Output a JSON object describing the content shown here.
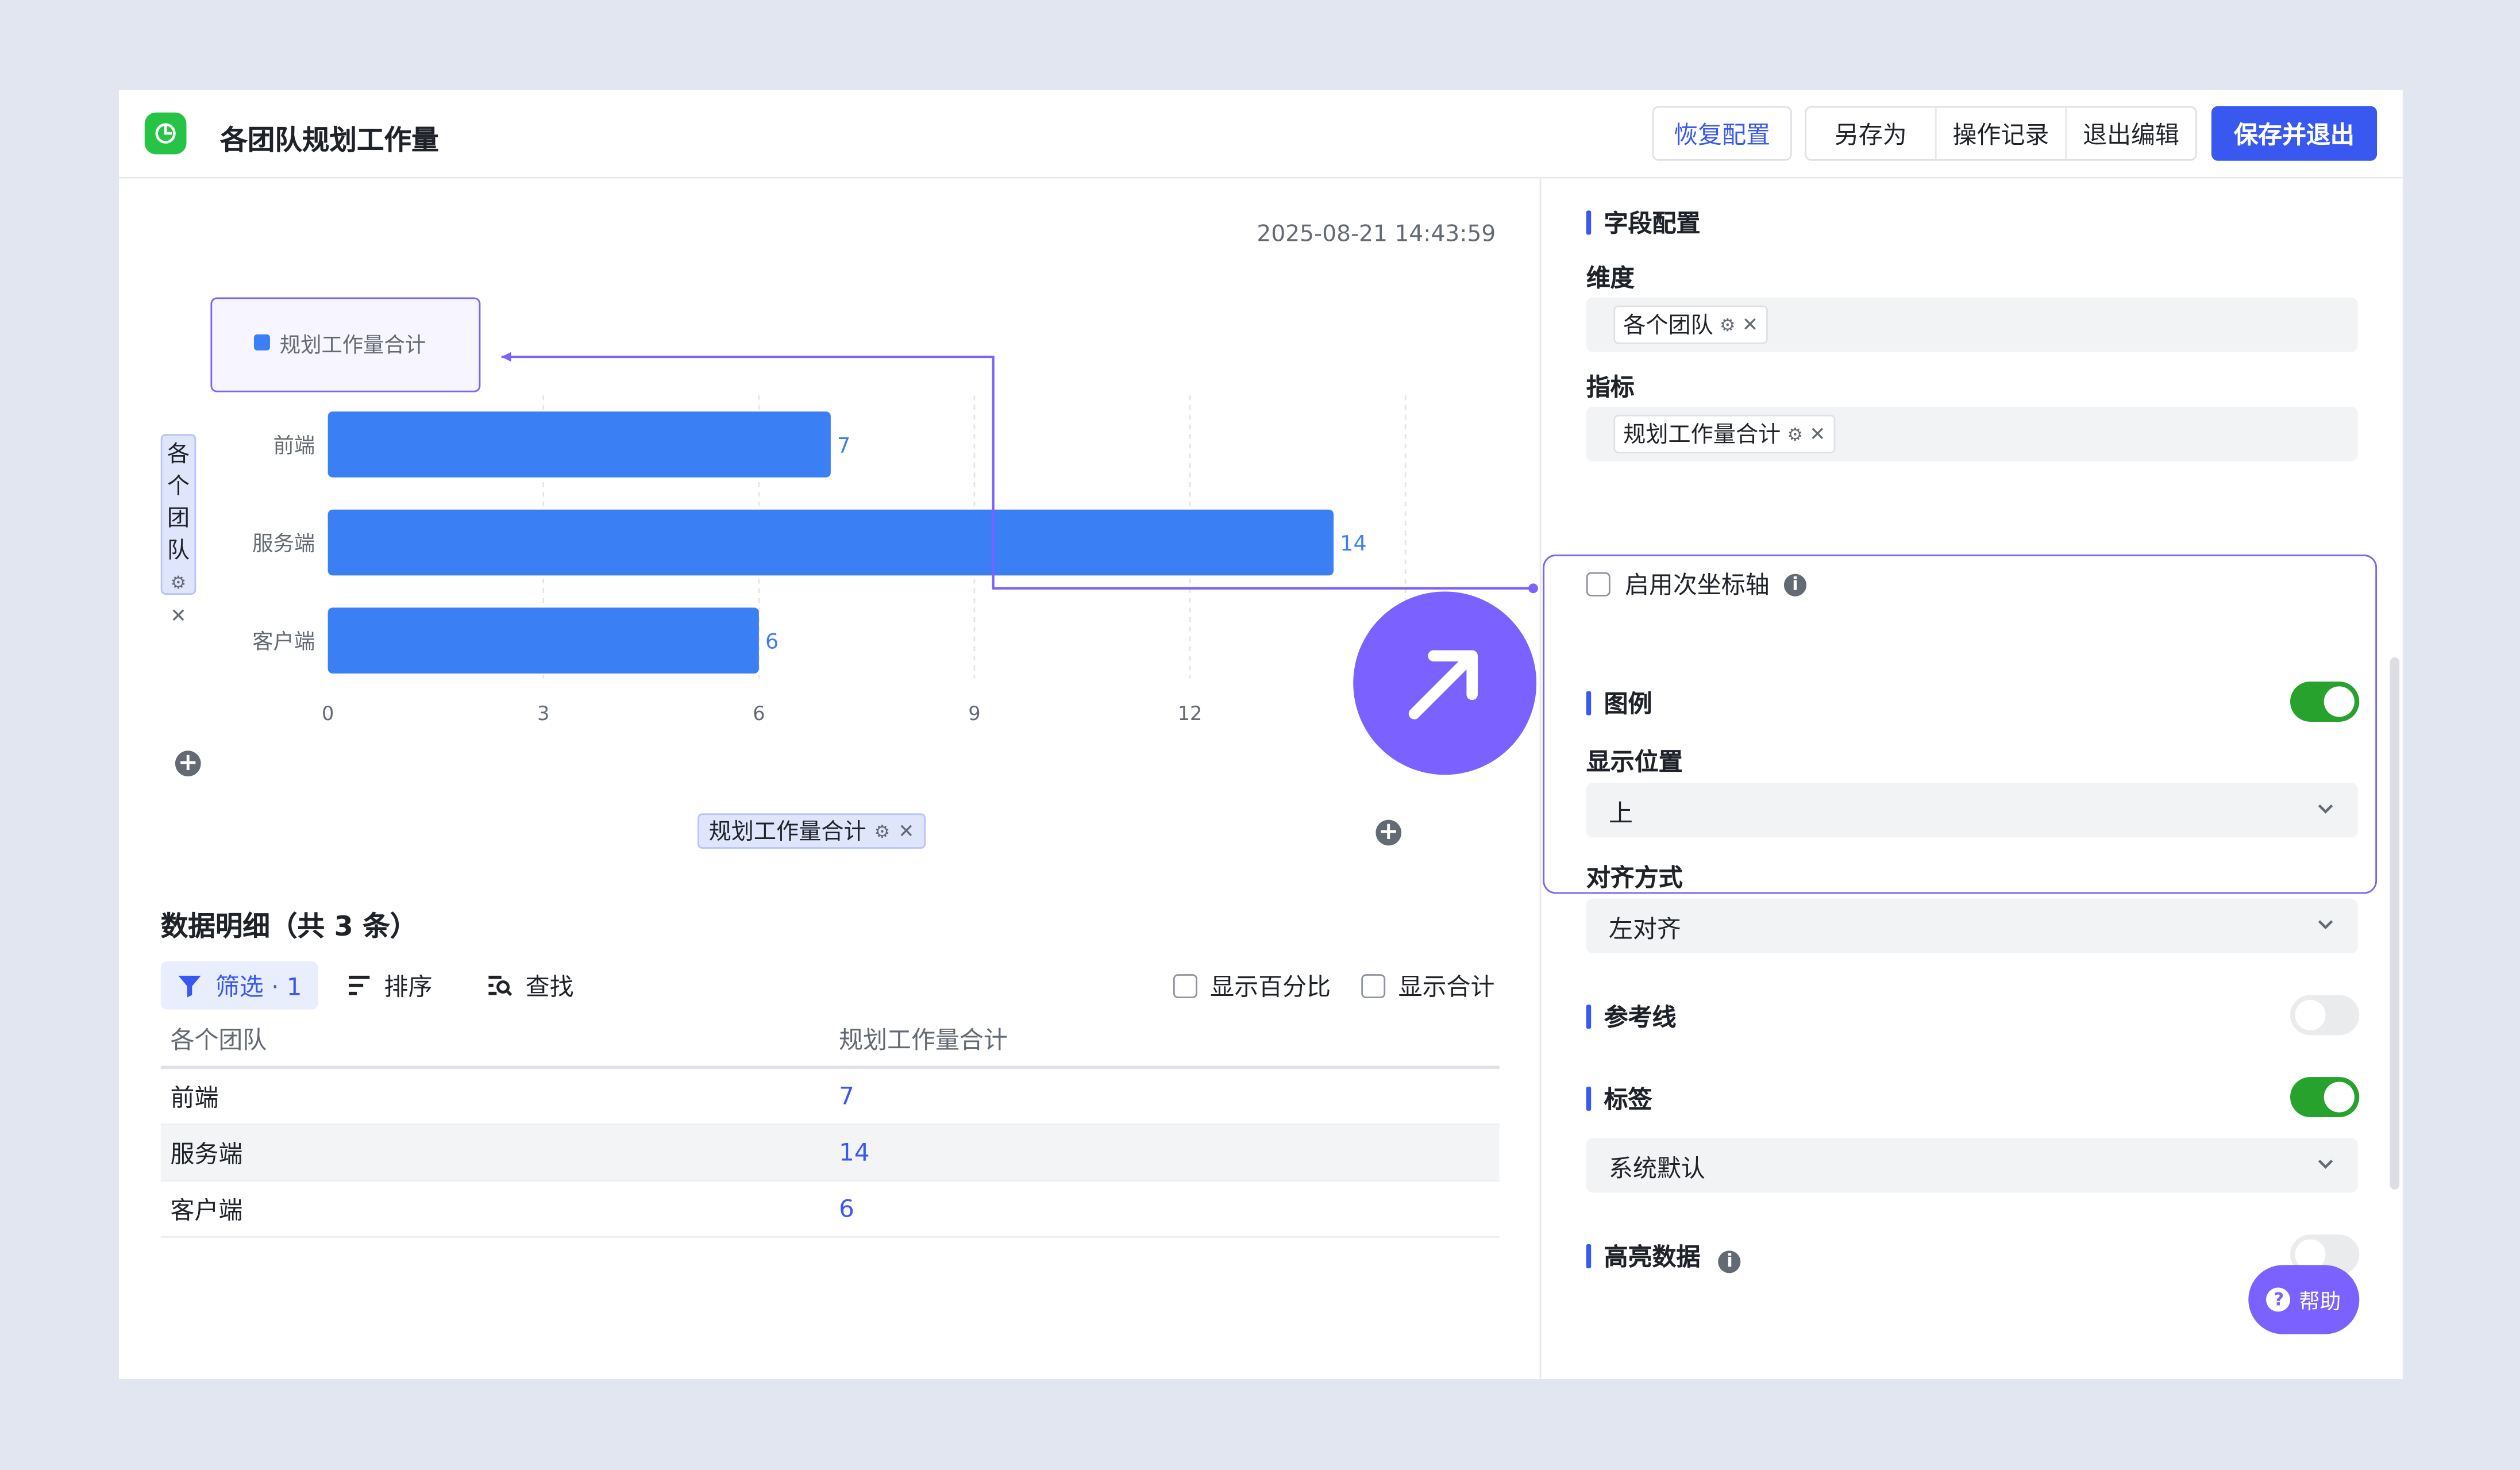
{
  "header": {
    "title": "各团队规划工作量",
    "restore_label": "恢复配置",
    "save_as_label": "另存为",
    "history_label": "操作记录",
    "exit_label": "退出编辑",
    "save_exit_label": "保存并退出"
  },
  "chart": {
    "timestamp": "2025-08-21 14:43:59",
    "y_field_chars": [
      "各",
      "个",
      "团",
      "队"
    ],
    "x_field": "规划工作量合计"
  },
  "chart_data": {
    "type": "bar",
    "orientation": "horizontal",
    "categories": [
      "前端",
      "服务端",
      "客户端"
    ],
    "series": [
      {
        "name": "规划工作量合计",
        "values": [
          7,
          14,
          6
        ],
        "color": "#3b7ff5"
      }
    ],
    "xticks": [
      "0",
      "3",
      "6",
      "9",
      "12"
    ],
    "xlim": [
      0,
      15
    ],
    "legend": "top-left",
    "grid": true,
    "data_labels": true
  },
  "details": {
    "title": "数据明细（共 3 条）",
    "filter_label": "筛选 · 1",
    "sort_label": "排序",
    "search_label": "查找",
    "show_percent_label": "显示百分比",
    "show_total_label": "显示合计",
    "columns": [
      "各个团队",
      "规划工作量合计"
    ],
    "rows": [
      {
        "team": "前端",
        "value": "7"
      },
      {
        "team": "服务端",
        "value": "14"
      },
      {
        "team": "客户端",
        "value": "6"
      }
    ]
  },
  "config": {
    "field_section": "字段配置",
    "dimension_label": "维度",
    "dimension_tag": "各个团队",
    "metric_label": "指标",
    "metric_tag": "规划工作量合计",
    "secondary_axis_label": "启用次坐标轴",
    "legend_section": "图例",
    "legend_on": true,
    "position_label": "显示位置",
    "position_value": "上",
    "align_label": "对齐方式",
    "align_value": "左对齐",
    "refline_section": "参考线",
    "refline_on": false,
    "label_section": "标签",
    "label_on": true,
    "label_value": "系统默认",
    "highlight_section": "高亮数据",
    "highlight_on": false
  },
  "help_label": "帮助",
  "colors": {
    "accent": "#3858f0",
    "bar": "#3b7ff5",
    "highlight": "#7b61ff",
    "toggle_on": "#27a22d"
  }
}
